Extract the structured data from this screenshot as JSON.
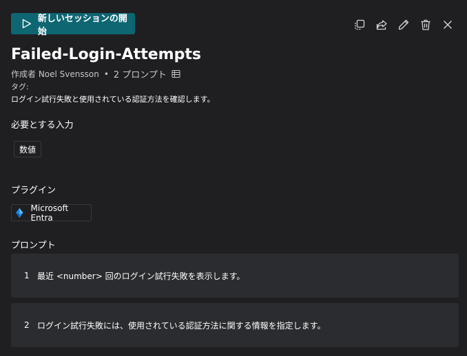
{
  "header": {
    "start_button_label": "新しいセッションの開始"
  },
  "toolbar": {
    "icons": [
      "duplicate-icon",
      "share-icon",
      "edit-icon",
      "delete-icon",
      "close-icon"
    ]
  },
  "promptbook": {
    "title": "Failed-Login-Attempts",
    "author": "作成者 Noel Svensson",
    "separator": "•",
    "prompt_count": "2 プロンプト",
    "tags_label": "タグ:",
    "description": "ログイン試行失敗と使用されている認証方法を確認します。"
  },
  "inputs": {
    "section_label": "必要とする入力",
    "items": [
      "数値"
    ]
  },
  "plugins": {
    "section_label": "プラグイン",
    "items": [
      "Microsoft Entra"
    ]
  },
  "prompts": {
    "section_label": "プロンプト",
    "items": [
      {
        "number": "1",
        "text": "最近 <number> 回のログイン試行失敗を表示します。"
      },
      {
        "number": "2",
        "text": "ログイン試行失敗には、使用されている認証方法に関する情報を指定します。"
      }
    ]
  },
  "colors": {
    "background": "#1f1f22",
    "accent": "#0e6672",
    "card": "#2b2c2f"
  }
}
